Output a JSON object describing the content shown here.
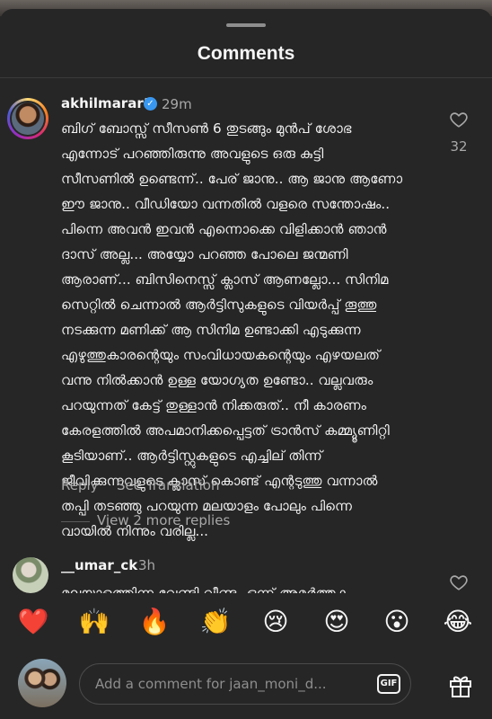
{
  "header": {
    "title": "Comments"
  },
  "comments": [
    {
      "username": "akhilmarar1",
      "time": "29m",
      "likes": "32",
      "lines": [
        "ബിഗ് ബോസ്സ് സീസൺ 6 തുടങ്ങും മുൻപ് ശോഭ",
        "എന്നോട് പറഞ്ഞിരുന്നു അവളുടെ ഒരു കുട്ടി",
        "സീസണിൽ ഉണ്ടെന്ന്.. പേര് ജാനു.. ആ ജാനു ആണോ",
        "ഈ ജാനു.. വീഡിയോ വന്നതിൽ വളരെ സന്തോഷം..",
        "പിന്നെ അവൻ ഇവൻ എന്നൊക്കെ വിളിക്കാൻ ഞാൻ",
        "ദാസ് അല്ല... അയ്യോ പറഞ്ഞ പോലെ ജന്മണി",
        "ആരാണ്... ബിസിനെസ്സ് ക്ലാസ് ആണല്ലോ... സിനിമ",
        "സെറ്റിൽ ചെന്നാൽ ആർട്ടിസുകളുടെ വിയർപ്പ് തൂത്തു",
        "നടക്കുന്ന മണിക്ക് ആ സിനിമ ഉണ്ടാക്കി എടുക്കുന്ന",
        "എഴുത്തുകാരന്റെയും സംവിധായകന്റെയും എഴയലത്",
        "വന്നു നിൽക്കാൻ ഉള്ള യോഗ്യത ഉണ്ടോ.. വല്ലവരും",
        "പറയുന്നത് കേട്ട് തുള്ളാൻ നിക്കരുത്.. നീ കാരണം",
        "കേരളത്തിൽ അപമാനിക്കപ്പെട്ടത് ട്രാൻസ് കമ്മ്യൂണിറ്റി",
        "കൂടിയാണ്.. ആർട്ടിസ്റ്റുകളുടെ എച്ചില് തിന്ന്",
        "ജീവിക്കുന്നവളുടെ ക്ലാസ് കൊണ്ട് എന്റടുത്തു വന്നാൽ",
        "തപ്പി തടഞ്ഞു പറയുന്ന മലയാളം പോലും പിന്നെ",
        "വായിൽ നിന്നും വരില്ല..."
      ],
      "reply_label": "Reply",
      "translation_label": "See Translation",
      "more_replies": "View 2 more replies"
    },
    {
      "username": "__umar_ck",
      "time": "3h",
      "lines": [
        "മലയാളത്തിന്ന വേണ്ടി വീണ്ടും ഒന്ന് അമർത്തുക"
      ]
    }
  ],
  "reactions": [
    "❤️",
    "🙌",
    "🔥",
    "👏",
    "😢",
    "😍",
    "😮",
    "😂"
  ],
  "composer": {
    "placeholder": "Add a comment for jaan_moni_d...",
    "gif_label": "GIF"
  },
  "icons": {
    "verified": "verified-badge-icon",
    "like": "heart-icon",
    "gift": "gift-icon"
  },
  "colors": {
    "background": "#262626",
    "verified": "#3897f0",
    "secondary_text": "#a8a8a8"
  }
}
